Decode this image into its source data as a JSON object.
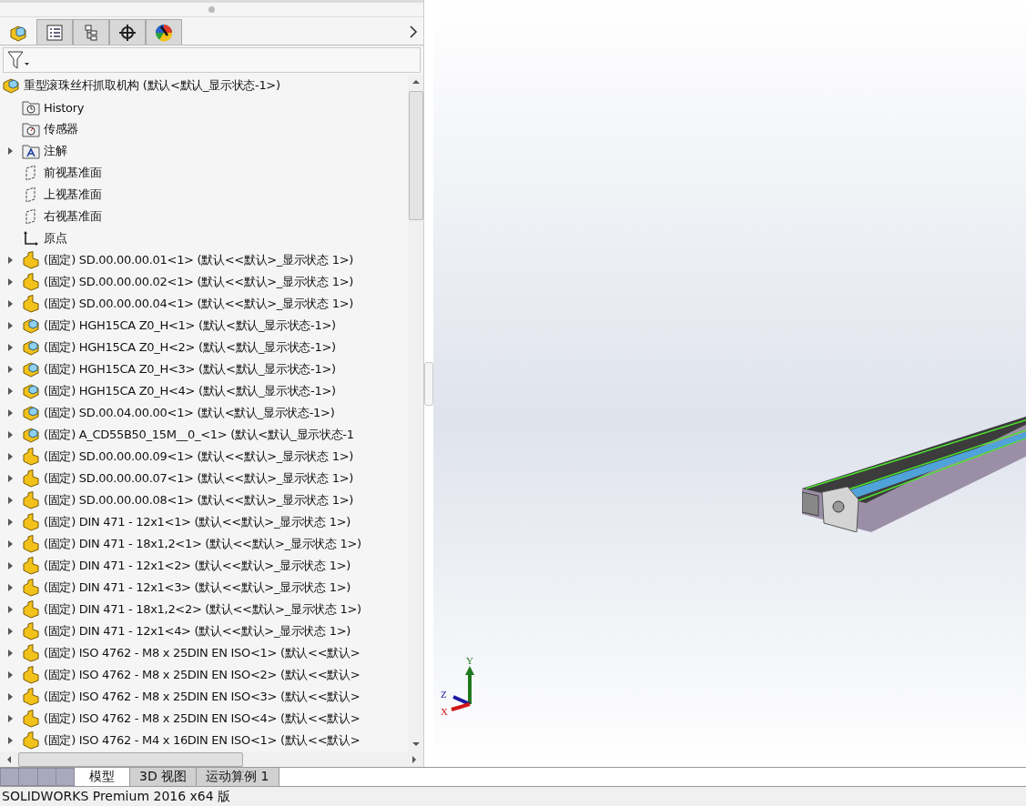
{
  "panel_tabs": [
    {
      "kind": "feature-tree",
      "selected": true
    },
    {
      "kind": "property",
      "selected": false
    },
    {
      "kind": "configuration",
      "selected": false
    },
    {
      "kind": "dimxpert",
      "selected": false
    },
    {
      "kind": "display",
      "selected": false
    }
  ],
  "tree": [
    {
      "kind": "assembly",
      "label": "重型滚珠丝杆抓取机构  (默认<默认_显示状态-1>)"
    },
    {
      "kind": "history",
      "label": "History"
    },
    {
      "kind": "sensor",
      "label": "传感器"
    },
    {
      "kind": "annotation",
      "label": "注解",
      "expanded": false
    },
    {
      "kind": "plane",
      "label": "前视基准面"
    },
    {
      "kind": "plane",
      "label": "上视基准面"
    },
    {
      "kind": "plane",
      "label": "右视基准面"
    },
    {
      "kind": "origin",
      "label": "原点"
    },
    {
      "kind": "part",
      "label": "(固定) SD.00.00.00.01<1> (默认<<默认>_显示状态 1>)",
      "expanded": false
    },
    {
      "kind": "part",
      "label": "(固定) SD.00.00.00.02<1> (默认<<默认>_显示状态 1>)",
      "expanded": false
    },
    {
      "kind": "part",
      "label": "(固定) SD.00.00.00.04<1> (默认<<默认>_显示状态 1>)",
      "expanded": false
    },
    {
      "kind": "assembly",
      "label": "(固定) HGH15CA Z0_H<1> (默认<默认_显示状态-1>)",
      "expanded": false
    },
    {
      "kind": "assembly",
      "label": "(固定) HGH15CA Z0_H<2> (默认<默认_显示状态-1>)",
      "expanded": false
    },
    {
      "kind": "assembly",
      "label": "(固定) HGH15CA Z0_H<3> (默认<默认_显示状态-1>)",
      "expanded": false
    },
    {
      "kind": "assembly",
      "label": "(固定) HGH15CA Z0_H<4> (默认<默认_显示状态-1>)",
      "expanded": false
    },
    {
      "kind": "assembly",
      "label": "(固定) SD.00.04.00.00<1> (默认<默认_显示状态-1>)",
      "expanded": false
    },
    {
      "kind": "assembly",
      "label": "(固定) A_CD55B50_15M__0_<1> (默认<默认_显示状态-1",
      "expanded": false
    },
    {
      "kind": "part",
      "label": "(固定) SD.00.00.00.09<1> (默认<<默认>_显示状态 1>)",
      "expanded": false
    },
    {
      "kind": "part",
      "label": "(固定) SD.00.00.00.07<1> (默认<<默认>_显示状态 1>)",
      "expanded": false
    },
    {
      "kind": "part",
      "label": "(固定) SD.00.00.00.08<1> (默认<<默认>_显示状态 1>)",
      "expanded": false
    },
    {
      "kind": "part",
      "label": "(固定) DIN 471 - 12x1<1> (默认<<默认>_显示状态 1>)",
      "expanded": false
    },
    {
      "kind": "part",
      "label": "(固定) DIN 471 - 18x1,2<1> (默认<<默认>_显示状态 1>)",
      "expanded": false
    },
    {
      "kind": "part",
      "label": "(固定) DIN 471 - 12x1<2> (默认<<默认>_显示状态 1>)",
      "expanded": false
    },
    {
      "kind": "part",
      "label": "(固定) DIN 471 - 12x1<3> (默认<<默认>_显示状态 1>)",
      "expanded": false
    },
    {
      "kind": "part",
      "label": "(固定) DIN 471 - 18x1,2<2> (默认<<默认>_显示状态 1>)",
      "expanded": false
    },
    {
      "kind": "part",
      "label": "(固定) DIN 471 - 12x1<4> (默认<<默认>_显示状态 1>)",
      "expanded": false
    },
    {
      "kind": "part",
      "label": "(固定) ISO 4762 - M8 x 25DIN EN ISO<1> (默认<<默认>",
      "expanded": false
    },
    {
      "kind": "part",
      "label": "(固定) ISO 4762 - M8 x 25DIN EN ISO<2> (默认<<默认>",
      "expanded": false
    },
    {
      "kind": "part",
      "label": "(固定) ISO 4762 - M8 x 25DIN EN ISO<3> (默认<<默认>",
      "expanded": false
    },
    {
      "kind": "part",
      "label": "(固定) ISO 4762 - M8 x 25DIN EN ISO<4> (默认<<默认>",
      "expanded": false
    },
    {
      "kind": "part",
      "label": "(固定) ISO 4762 - M4 x 16DIN EN ISO<1> (默认<<默认>",
      "expanded": false
    }
  ],
  "bottom_tabs": [
    {
      "label": "模型",
      "selected": true
    },
    {
      "label": "3D 视图",
      "selected": false
    },
    {
      "label": "运动算例 1",
      "selected": false
    }
  ],
  "triad": {
    "x": "X",
    "y": "Y",
    "z": "Z"
  },
  "status_bar": "SOLIDWORKS Premium 2016 x64 版"
}
